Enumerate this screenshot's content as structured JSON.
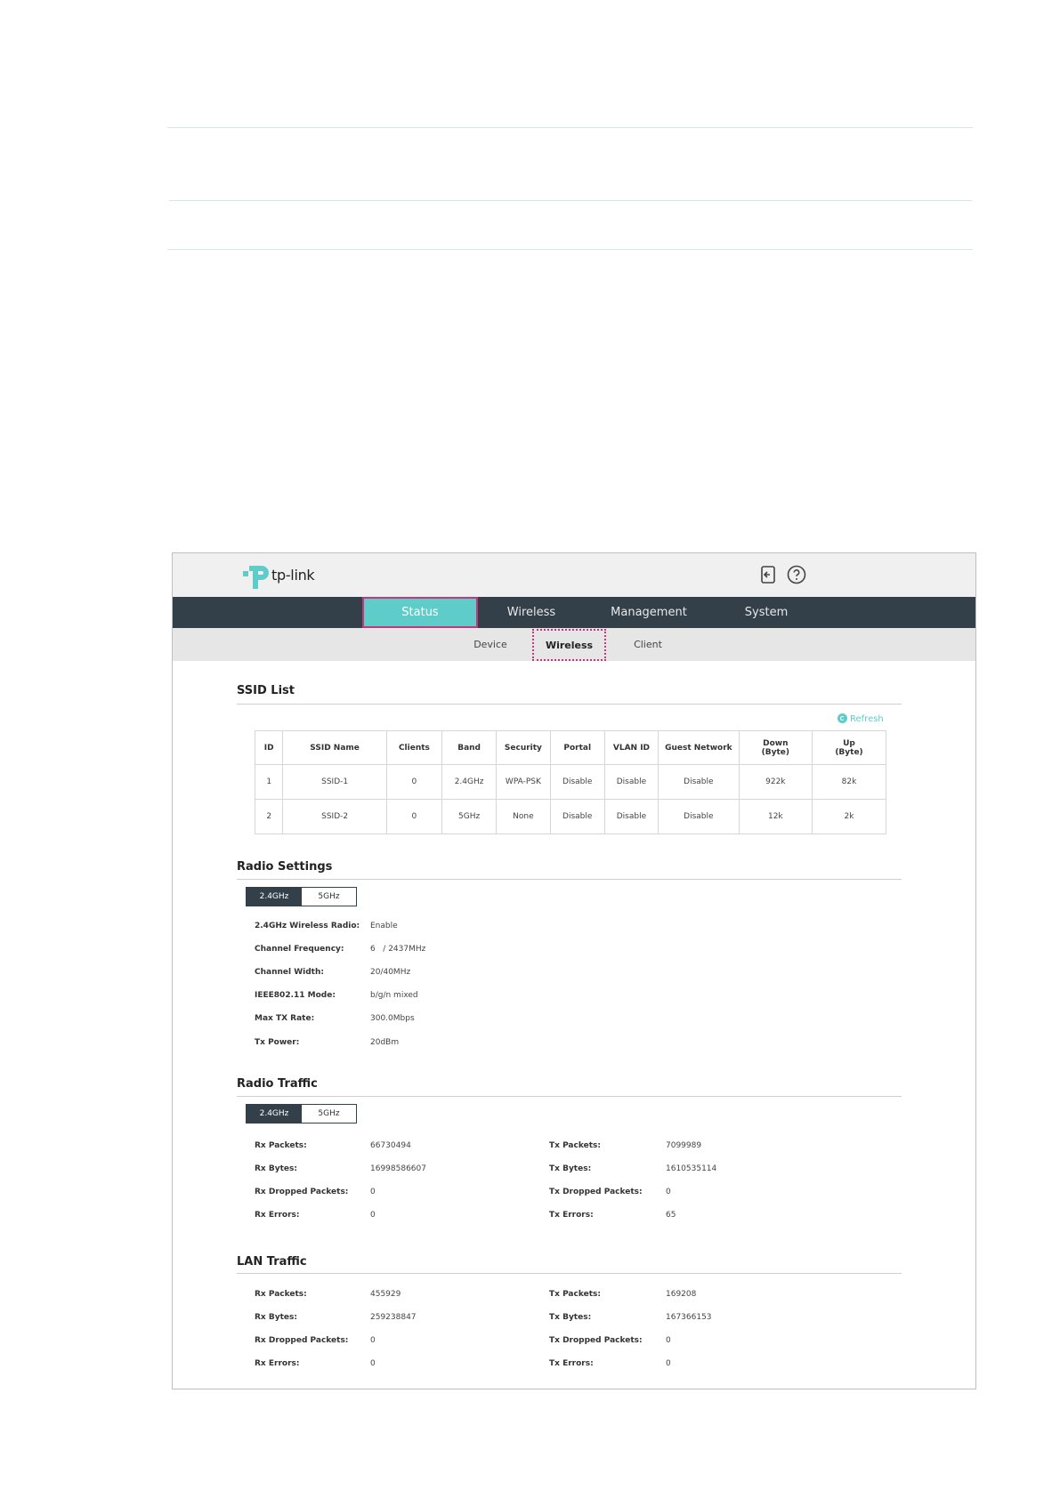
{
  "app": {
    "logo_text": "tp-link"
  },
  "nav": {
    "items": [
      "Status",
      "Wireless",
      "Management",
      "System"
    ],
    "active": "Status"
  },
  "subnav": {
    "items": [
      "Device",
      "Wireless",
      "Client"
    ],
    "active": "Wireless"
  },
  "colors": {
    "accent": "#5ecdc9",
    "nav_bg": "#33404a",
    "highlight_border": "#c8347d"
  },
  "ssid_list": {
    "title": "SSID List",
    "refresh_label": "Refresh",
    "columns": [
      "ID",
      "SSID Name",
      "Clients",
      "Band",
      "Security",
      "Portal",
      "VLAN ID",
      "Guest Network",
      "Down (Byte)",
      "Up (Byte)"
    ],
    "rows": [
      [
        "1",
        "SSID-1",
        "0",
        "2.4GHz",
        "WPA-PSK",
        "Disable",
        "Disable",
        "Disable",
        "922k",
        "82k"
      ],
      [
        "2",
        "SSID-2",
        "0",
        "5GHz",
        "None",
        "Disable",
        "Disable",
        "Disable",
        "12k",
        "2k"
      ]
    ]
  },
  "radio_settings": {
    "title": "Radio Settings",
    "tabs": [
      "2.4GHz",
      "5GHz"
    ],
    "fields": [
      {
        "label": "2.4GHz Wireless Radio:",
        "value": "Enable"
      },
      {
        "label": "Channel Frequency:",
        "value": "6   / 2437MHz"
      },
      {
        "label": "Channel Width:",
        "value": "20/40MHz"
      },
      {
        "label": "IEEE802.11 Mode:",
        "value": "b/g/n mixed"
      },
      {
        "label": "Max TX Rate:",
        "value": "300.0Mbps"
      },
      {
        "label": "Tx Power:",
        "value": "20dBm"
      }
    ]
  },
  "radio_traffic": {
    "title": "Radio Traffic",
    "tabs": [
      "2.4GHz",
      "5GHz"
    ],
    "rx": [
      {
        "label": "Rx Packets:",
        "value": "66730494"
      },
      {
        "label": "Rx Bytes:",
        "value": "16998586607"
      },
      {
        "label": "Rx Dropped Packets:",
        "value": "0"
      },
      {
        "label": "Rx Errors:",
        "value": "0"
      }
    ],
    "tx": [
      {
        "label": "Tx Packets:",
        "value": "7099989"
      },
      {
        "label": "Tx Bytes:",
        "value": "1610535114"
      },
      {
        "label": "Tx Dropped Packets:",
        "value": "0"
      },
      {
        "label": "Tx Errors:",
        "value": "65"
      }
    ]
  },
  "lan_traffic": {
    "title": "LAN Traffic",
    "rx": [
      {
        "label": "Rx Packets:",
        "value": "455929"
      },
      {
        "label": "Rx Bytes:",
        "value": "259238847"
      },
      {
        "label": "Rx Dropped Packets:",
        "value": "0"
      },
      {
        "label": "Rx Errors:",
        "value": "0"
      }
    ],
    "tx": [
      {
        "label": "Tx Packets:",
        "value": "169208"
      },
      {
        "label": "Tx Bytes:",
        "value": "167366153"
      },
      {
        "label": "Tx Dropped Packets:",
        "value": "0"
      },
      {
        "label": "Tx Errors:",
        "value": "0"
      }
    ]
  }
}
